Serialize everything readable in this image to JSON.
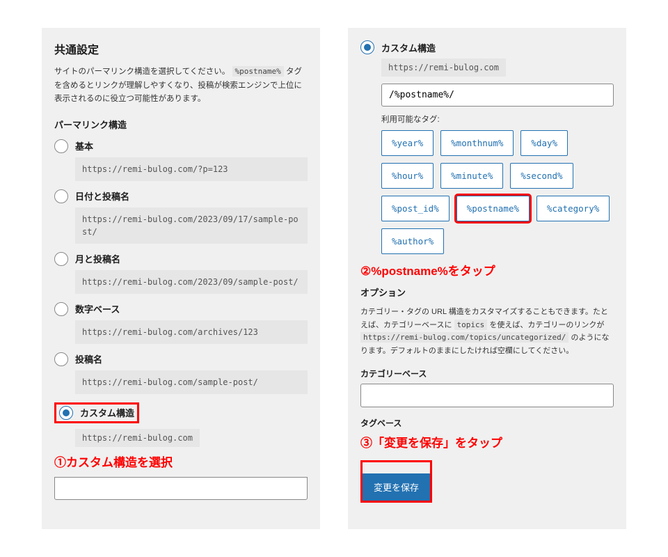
{
  "left": {
    "title": "共通設定",
    "desc_before": "サイトのパーマリンク構造を選択してください。",
    "desc_tag": "%postname%",
    "desc_after": "タグを含めるとリンクが理解しやすくなり、投稿が検索エンジンで上位に表示されるのに役立つ可能性があります。",
    "structure_title": "パーマリンク構造",
    "options": [
      {
        "label": "基本",
        "url": "https://remi-bulog.com/?p=123"
      },
      {
        "label": "日付と投稿名",
        "url": "https://remi-bulog.com/2023/09/17/sample-post/"
      },
      {
        "label": "月と投稿名",
        "url": "https://remi-bulog.com/2023/09/sample-post/"
      },
      {
        "label": "数字ベース",
        "url": "https://remi-bulog.com/archives/123"
      },
      {
        "label": "投稿名",
        "url": "https://remi-bulog.com/sample-post/"
      }
    ],
    "custom_label": "カスタム構造",
    "custom_base": "https://remi-bulog.com",
    "annotation1": "①カスタム構造を選択"
  },
  "right": {
    "custom_label": "カスタム構造",
    "custom_base": "https://remi-bulog.com",
    "custom_value": "/%postname%/",
    "tags_label": "利用可能なタグ:",
    "tags": [
      "%year%",
      "%monthnum%",
      "%day%",
      "%hour%",
      "%minute%",
      "%second%",
      "%post_id%",
      "%postname%",
      "%category%",
      "%author%"
    ],
    "annotation2": "②%postname%をタップ",
    "option_title": "オプション",
    "opt_desc_1": "カテゴリー・タグの URL 構造をカスタマイズすることもできます。たとえば、カテゴリーベースに ",
    "opt_desc_tag1": "topics",
    "opt_desc_2": " を使えば、カテゴリーのリンクが ",
    "opt_desc_tag2": "https://remi-bulog.com/topics/uncategorized/",
    "opt_desc_3": " のようになります。デフォルトのままにしたければ空欄にしてください。",
    "cat_base_label": "カテゴリーベース",
    "tag_base_label": "タグベース",
    "annotation3": "③「変更を保存」をタップ",
    "save_label": "変更を保存"
  }
}
